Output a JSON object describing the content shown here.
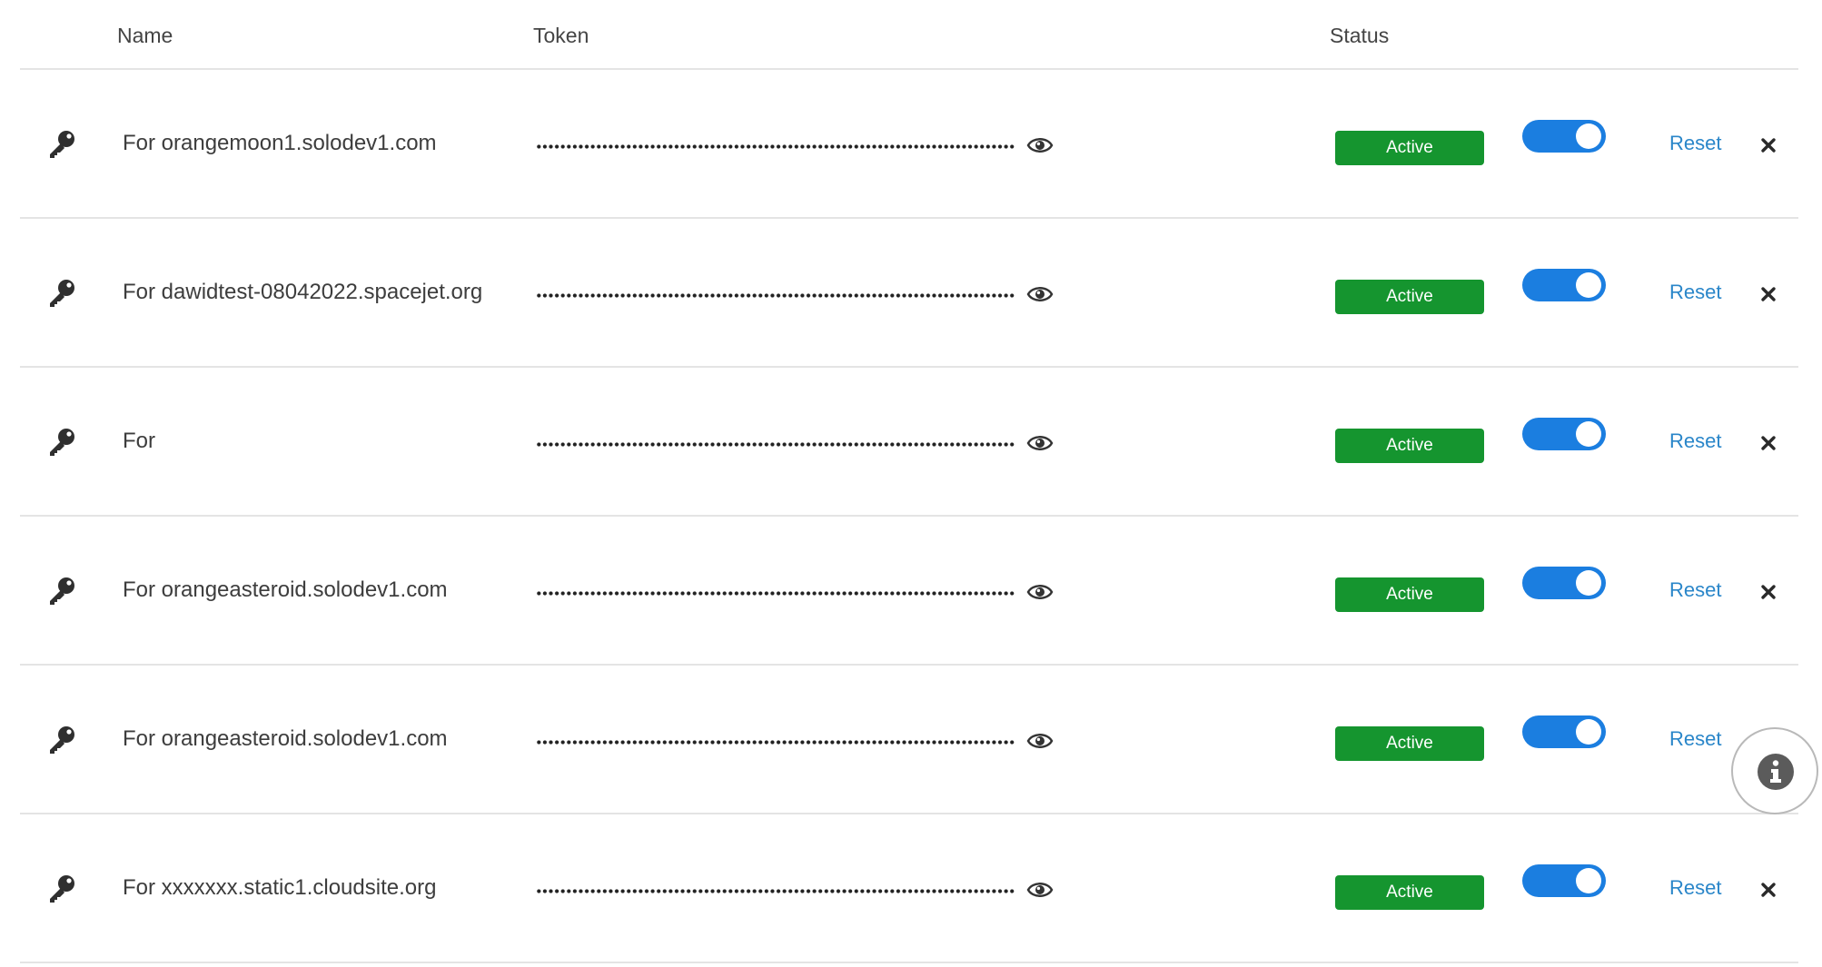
{
  "columns": {
    "name": "Name",
    "token": "Token",
    "status": "Status"
  },
  "rows": [
    {
      "name": "For orangemoon1.solodev1.com",
      "status": "Active",
      "reset": "Reset",
      "enabled": true,
      "close_visible": true
    },
    {
      "name": "For dawidtest-08042022.spacejet.org",
      "status": "Active",
      "reset": "Reset",
      "enabled": true,
      "close_visible": true
    },
    {
      "name": "For",
      "status": "Active",
      "reset": "Reset",
      "enabled": true,
      "close_visible": true
    },
    {
      "name": "For orangeasteroid.solodev1.com",
      "status": "Active",
      "reset": "Reset",
      "enabled": true,
      "close_visible": true
    },
    {
      "name": "For orangeasteroid.solodev1.com",
      "status": "Active",
      "reset": "Reset",
      "enabled": true,
      "close_visible": false
    },
    {
      "name": "For xxxxxxx.static1.cloudsite.org",
      "status": "Active",
      "reset": "Reset",
      "enabled": true,
      "close_visible": true
    }
  ],
  "icons": {
    "row_icon": "key-icon",
    "reveal": "eye-icon",
    "remove": "close-icon",
    "floating": "info-icon"
  },
  "colors": {
    "status_active": "#15952f",
    "toggle_on": "#1b7ee0",
    "link": "#2a86c9"
  }
}
